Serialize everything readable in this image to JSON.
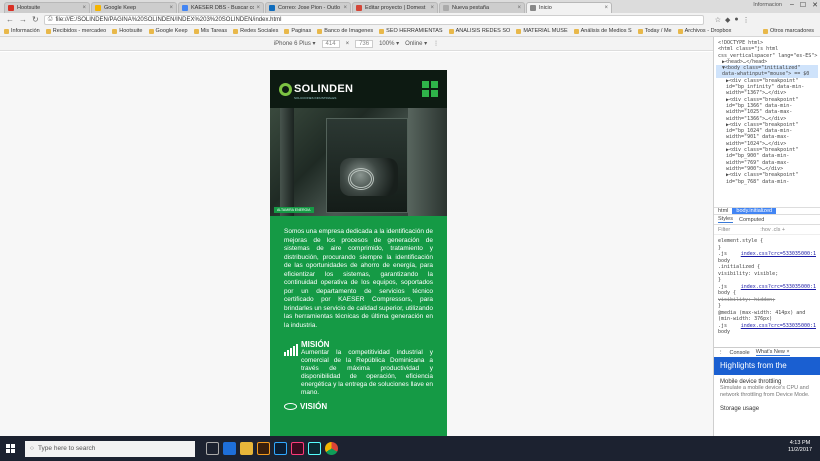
{
  "tabs": [
    {
      "label": "Hootsuite",
      "color": "#d93025"
    },
    {
      "label": "Google Keep",
      "color": "#f4b400"
    },
    {
      "label": "KAESER DBS - Buscar con",
      "color": "#4285f4"
    },
    {
      "label": "Correo: Jose Pion - Outlo",
      "color": "#0f6cbd"
    },
    {
      "label": "Editar proyecto | Domest",
      "color": "#d44638"
    },
    {
      "label": "Nueva pestaña",
      "color": "#aaaaaa"
    },
    {
      "label": "Inicio",
      "color": "#888888",
      "active": true
    }
  ],
  "user_badge": "Informacion",
  "url": "file:///E:/SOLINDEN/PAGINA%20SOLINDEN/INDEX%203%20SOLINDEN/index.html",
  "bookmarks": [
    "Información",
    "Recibidos - mercadeo",
    "Hootsuite",
    "Google Keep",
    "Mis Tareas",
    "Redes Sociales",
    "Paginas",
    "Banco de Imagenes",
    "SEO HERRAMIENTAS",
    "ANALISIS REDES SO",
    "MATERIAL MUSE",
    "Análisis de Medios S",
    "Today / Me",
    "Archivos - Dropbox"
  ],
  "other_bookmarks": "Otros marcadores",
  "device_toolbar": {
    "device": "iPhone 6 Plus ▾",
    "width": "414",
    "height": "736",
    "zoom": "100% ▾",
    "network": "Online ▾"
  },
  "site": {
    "logo": "SOLINDEN",
    "logo_sub": "SOLUCIONES INDUSTRIALES",
    "hero_caption": "ALTAMIRA ENERGIA",
    "intro": "Somos una empresa dedicada a la identificación de mejoras de los procesos de generación de sistemas de aire comprimido, tratamiento y distribución, procurando siempre la identificación de las oportunidades de ahorro de energía, para eficientizar los sistemas, garantizando la continuidad operativa de los equipos, soportados por un departamento de servicios técnico certificado por KAESER Compressors, para brindarles un servicio de calidad superior, utilizando las herramientas técnicas de última generación en la industria.",
    "mision_title": "MISIÓN",
    "mision_text": "Aumentar la competitividad industrial y comercial de la República Dominicana a través de máxima productividad y disponibilidad de operación, eficiencia energética y la entrega de soluciones llave en mano.",
    "vision_title": "VISIÓN"
  },
  "devtools": {
    "dom": [
      "<!DOCTYPE html>",
      "<html class=\"js html css_verticalspacer\" lang=\"es-ES\">",
      "▶<head>…</head>",
      "▼<body class=\"initialized\" data-whatinput=\"mouse\"> == $0",
      "▶<div class=\"breakpoint\" id=\"bp_infinity\" data-min-width=\"1367\">…</div>",
      "▶<div class=\"breakpoint\" id=\"bp_1366\" data-min-width=\"1025\" data-max-width=\"1366\">…</div>",
      "▶<div class=\"breakpoint\" id=\"bp_1024\" data-min-width=\"901\" data-max-width=\"1024\">…</div>",
      "▶<div class=\"breakpoint\" id=\"bp_900\" data-min-width=\"769\" data-max-width=\"900\">…</div>",
      "▶<div class=\"breakpoint\" id=\"bp_768\" data-min-"
    ],
    "crumbs": [
      "html",
      "body.initialized"
    ],
    "style_tabs": [
      "Styles",
      "Computed"
    ],
    "filter": "Filter",
    "filter_opts": ":hov  .cls  +",
    "styles": [
      {
        "line": "element.style {",
        "src": ""
      },
      {
        "line": "}",
        "src": ""
      },
      {
        "line": ".js",
        "src": "index.css?crc=533035000:1"
      },
      {
        "line": "body",
        "src": ""
      },
      {
        "line": ".initialized {",
        "src": ""
      },
      {
        "line": "  visibility: visible;",
        "src": ""
      },
      {
        "line": "}",
        "src": ""
      },
      {
        "line": ".js",
        "src": "index.css?crc=533035000:1"
      },
      {
        "line": "body {",
        "src": ""
      },
      {
        "line": "  visibility: hidden;",
        "src": "",
        "strike": true
      },
      {
        "line": "}",
        "src": ""
      },
      {
        "line": "@media (max-width: 414px) and (min-width: 376px)",
        "src": ""
      },
      {
        "line": ".js",
        "src": "index.css?crc=533035000:1"
      },
      {
        "line": "body",
        "src": ""
      }
    ],
    "drawer_tabs": [
      "Console",
      "What's New ×"
    ],
    "banner": "Highlights from the",
    "drawer_items": [
      {
        "title": "Mobile device throttling",
        "desc": "Simulate a mobile device's CPU and network throttling from Device Mode."
      },
      {
        "title": "Storage usage",
        "desc": ""
      }
    ]
  },
  "taskbar": {
    "search": "Type here to search",
    "time": "4:13 PM",
    "date": "11/2/2017"
  }
}
